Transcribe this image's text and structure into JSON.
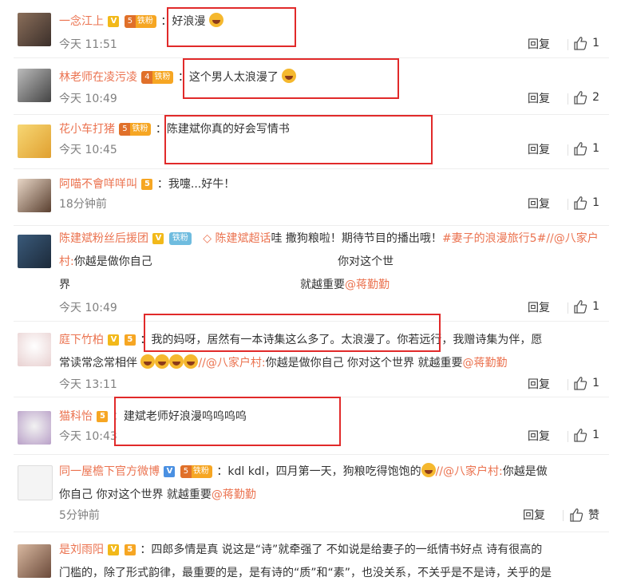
{
  "like_label_zan": "赞",
  "reply_label": "回复",
  "comments": [
    {
      "user": "一念江上",
      "fan": "铁粉",
      "lvl": "5",
      "text": "：好浪漫",
      "time": "今天 11:51",
      "likes": "1"
    },
    {
      "user": "林老师在凌污凌",
      "fan": "铁粉",
      "lvl": "4",
      "text": "：这个男人太浪漫了",
      "time": "今天 10:49",
      "likes": "2"
    },
    {
      "user": "花小车打猪",
      "fan": "铁粉",
      "lvl": "5",
      "text": "：陈建斌你真的好会写情书",
      "time": "今天 10:45",
      "likes": "1"
    },
    {
      "user": "阿喵不會咩咩叫",
      "lvl": "5",
      "text": "：我嚏...好牛！",
      "time": "18分钟前",
      "likes": "1"
    },
    {
      "user": "陈建斌粉丝后援团",
      "fan": "铁粉",
      "supertopic": "陈建斌超话",
      "t1": "哇 撒狗粮啦！期待节目的播出哦！",
      "tag": "#妻子的浪漫旅行5#",
      "mention1": "//@八家户村:",
      "t2": "你越是做你自己",
      "t3": "你对这个世",
      "t4": "界",
      "t5": "就越重要",
      "mention2": "@蒋勤勤",
      "time": "今天 10:49",
      "likes": "1"
    },
    {
      "user": "庭下竹柏",
      "lvl": "5",
      "line1": "：我的妈呀，居然有一本诗集这么多了。太浪漫了。你若远行，我赠诗集为伴，愿",
      "line2a": "常读常念常相伴",
      "mention1": "//@八家户村:",
      "line2b": "你越是做你自己  你对这个世界  就越重要",
      "mention2": "@蒋勤勤",
      "time": "今天 13:11",
      "likes": "1"
    },
    {
      "user": "猫科怡",
      "lvl": "5",
      "text": "：建斌老师好浪漫呜呜呜呜",
      "time": "今天 10:43",
      "likes": "1"
    },
    {
      "user": "同一屋檐下官方微博",
      "fan": "铁粉",
      "lvl": "5",
      "line1": "：kdl kdl，四月第一天，狗粮吃得饱饱的",
      "mention1": "//@八家户村:",
      "line1b": "你越是做",
      "line2": "你自己  你对这个世界 就越重要",
      "mention2": "@蒋勤勤",
      "time": "5分钟前"
    },
    {
      "user": "是刘雨阳",
      "lvl": "5",
      "line1": "：四郎多情是真 说这是“诗”就牵强了 不如说是给妻子的一纸情书好点  诗有很高的",
      "line2": "门槛的，除了形式韵律，最重要的是，是有诗的“质”和“素”，也没关系，不关乎是不是诗，关乎的是"
    }
  ],
  "colors": {
    "username": "#eb7350",
    "box": "#e12a2a",
    "time": "#808080"
  }
}
